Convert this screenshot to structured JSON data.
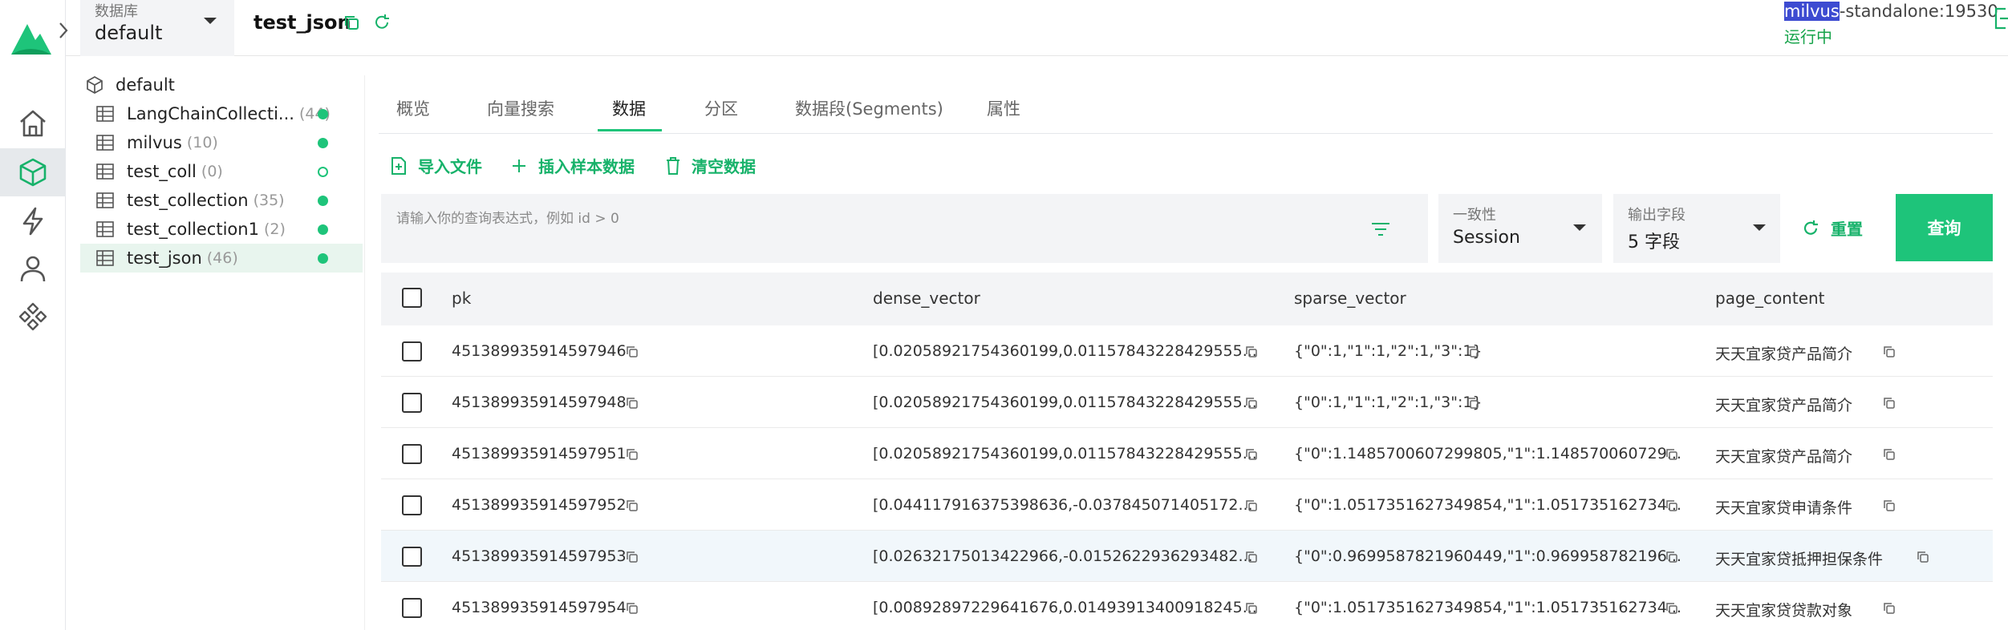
{
  "app": {
    "db_label": "数据库",
    "db_value": "default",
    "collection_title": "test_json",
    "server_name_highlight": "milvus",
    "server_name_rest": "-standalone:19530",
    "server_status": "运行中"
  },
  "tree": {
    "root": "default",
    "items": [
      {
        "label": "LangChainCollecti...",
        "count": "(44)",
        "status": "loaded"
      },
      {
        "label": "milvus",
        "count": "(10)",
        "status": "loaded"
      },
      {
        "label": "test_coll",
        "count": "(0)",
        "status": "unloaded"
      },
      {
        "label": "test_collection",
        "count": "(35)",
        "status": "loaded"
      },
      {
        "label": "test_collection1",
        "count": "(2)",
        "status": "loaded"
      },
      {
        "label": "test_json",
        "count": "(46)",
        "status": "loaded"
      }
    ]
  },
  "tabs": [
    "概览",
    "向量搜索",
    "数据",
    "分区",
    "数据段(Segments)",
    "属性"
  ],
  "actions": {
    "import": "导入文件",
    "insert": "插入样本数据",
    "clear": "清空数据"
  },
  "query": {
    "placeholder": "请输入你的查询表达式，例如 id > 0",
    "consistency_label": "一致性",
    "consistency_value": "Session",
    "output_label": "输出字段",
    "output_value": "5 字段",
    "reset": "重置",
    "submit": "查询"
  },
  "table": {
    "headers": [
      "pk",
      "dense_vector",
      "sparse_vector",
      "page_content"
    ],
    "rows": [
      [
        "451389935914597946",
        "[0.02058921754360199,0.01157843228429555...",
        "{\"0\":1,\"1\":1,\"2\":1,\"3\":1}",
        "天天宜家贷产品简介"
      ],
      [
        "451389935914597948",
        "[0.02058921754360199,0.01157843228429555...",
        "{\"0\":1,\"1\":1,\"2\":1,\"3\":1}",
        "天天宜家贷产品简介"
      ],
      [
        "451389935914597951",
        "[0.02058921754360199,0.01157843228429555...",
        "{\"0\":1.1485700607299805,\"1\":1.148570060729...",
        "天天宜家贷产品简介"
      ],
      [
        "451389935914597952",
        "[0.044117916375398636,-0.037845071405172...",
        "{\"0\":1.0517351627349854,\"1\":1.051735162734...",
        "天天宜家贷申请条件"
      ],
      [
        "451389935914597953",
        "[0.02632175013422966,-0.0152622936293482...",
        "{\"0\":0.9699587821960449,\"1\":0.969958782196...",
        "天天宜家贷抵押担保条件"
      ],
      [
        "451389935914597954",
        "[0.00892897229641676,0.01493913400918245...",
        "{\"0\":1.0517351627349854,\"1\":1.051735162734...",
        "天天宜家贷贷款对象"
      ]
    ]
  },
  "colors": {
    "accent": "#1ec47a",
    "accent_text": "#17b26a"
  }
}
